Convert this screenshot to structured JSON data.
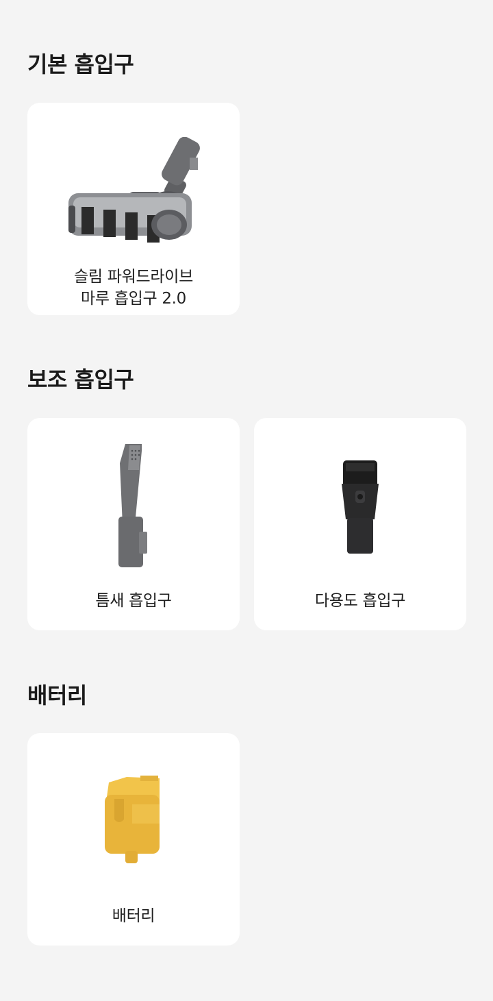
{
  "sections": [
    {
      "title": "기본 흡입구",
      "items": [
        {
          "label_line1": "슬림 파워드라이브",
          "label_line2": "마루 흡입구 2.0",
          "icon": "powerdrive-floor-nozzle-icon"
        }
      ]
    },
    {
      "title": "보조 흡입구",
      "items": [
        {
          "label": "틈새 흡입구",
          "icon": "crevice-nozzle-icon"
        },
        {
          "label": "다용도 흡입구",
          "icon": "multi-purpose-nozzle-icon"
        }
      ]
    },
    {
      "title": "배터리",
      "items": [
        {
          "label": "배터리",
          "icon": "battery-icon"
        }
      ]
    }
  ],
  "colors": {
    "background": "#f4f4f4",
    "card": "#ffffff",
    "battery": "#e8b43a",
    "nozzle_gray": "#6b6b6d",
    "nozzle_dark": "#2a2a2a"
  }
}
